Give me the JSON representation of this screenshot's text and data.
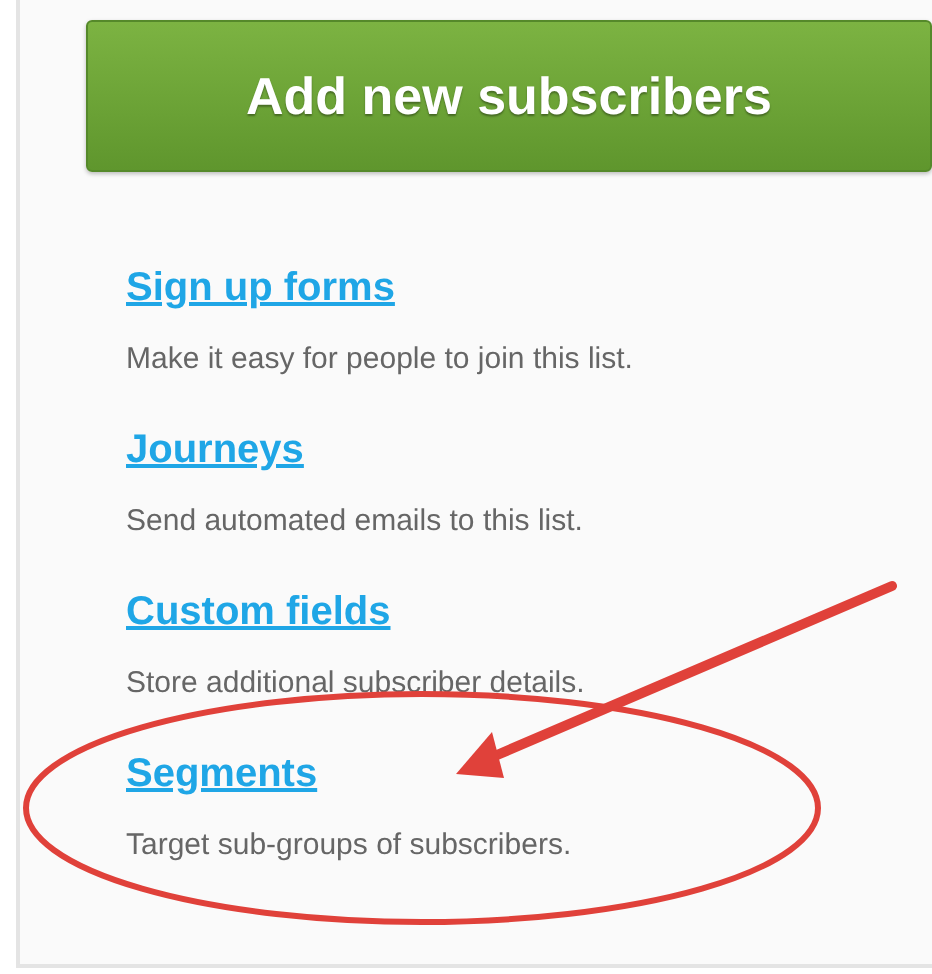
{
  "primary_button": {
    "label": "Add new subscribers"
  },
  "links": [
    {
      "title": "Sign up forms",
      "description": "Make it easy for people to join this list.",
      "highlighted": false
    },
    {
      "title": "Journeys",
      "description": "Send automated emails to this list.",
      "highlighted": false
    },
    {
      "title": "Custom fields",
      "description": "Store additional subscriber details.",
      "highlighted": false
    },
    {
      "title": "Segments",
      "description": "Target sub-groups of subscribers.",
      "highlighted": true
    }
  ]
}
